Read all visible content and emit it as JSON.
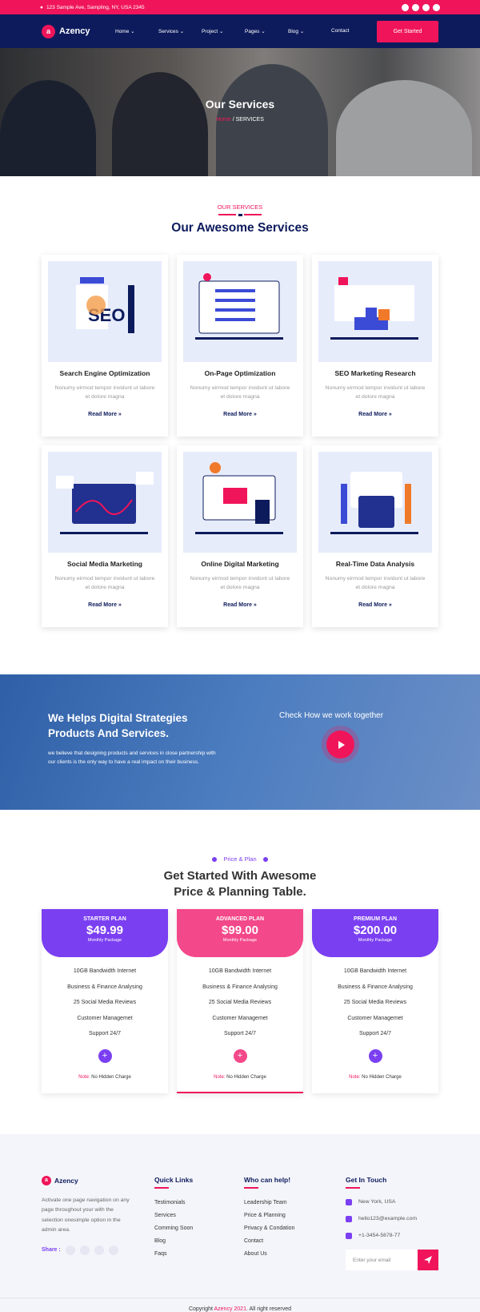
{
  "topbar": {
    "address": "123 Sample Ave, Sampling, NY, USA 2345"
  },
  "nav": {
    "brand": "Azency",
    "items": [
      "Home",
      "Services",
      "Project",
      "Pages",
      "Blog",
      "Contact"
    ],
    "cta": "Get Started"
  },
  "hero": {
    "title": "Our Services",
    "crumb_home": "Home",
    "crumb_current": " / SERVICES"
  },
  "services": {
    "eyebrow": "OUR SERVICES",
    "title": "Our Awesome Services",
    "cards": [
      {
        "title": "Search Engine Optimization",
        "text": "Nonumy eirmod tempor invidunt ut labore et dolore magna",
        "link": "Read More"
      },
      {
        "title": "On-Page Optimization",
        "text": "Nonumy eirmod tempor invidunt ut labore et dolore magna",
        "link": "Read More"
      },
      {
        "title": "SEO Marketing Research",
        "text": "Nonumy eirmod tempor invidunt ut labore et dolore magna",
        "link": "Read More"
      },
      {
        "title": "Social Media Marketing",
        "text": "Nonumy eirmod tempor invidunt ut labore et dolore magna",
        "link": "Read More"
      },
      {
        "title": "Online Digital Marketing",
        "text": "Nonumy eirmod tempor invidunt ut labore et dolore magna",
        "link": "Read More"
      },
      {
        "title": "Real-Time Data Analysis",
        "text": "Nonumy eirmod tempor invidunt ut labore et dolore magna",
        "link": "Read More"
      }
    ]
  },
  "strategy": {
    "title_line1": "We Helps Digital Strategies",
    "title_line2": "Products And Services.",
    "text": "we believe that designing products and services in close partnership with our clients is the only way to have a real impact on their business.",
    "video_label": "Check How we work together"
  },
  "pricing": {
    "eyebrow": "Price & Plan",
    "title_line1": "Get Started With Awesome",
    "title_line2": "Price & Planning Table.",
    "plans": [
      {
        "name": "STARTER PLAN",
        "price": "$49.99",
        "period": "Monthly Package",
        "color": "#7b3ff2"
      },
      {
        "name": "ADVANCED PLAN",
        "price": "$99.00",
        "period": "Monthly Package",
        "color": "#f3488a"
      },
      {
        "name": "PREMIUM PLAN",
        "price": "$200.00",
        "period": "Monthly Package",
        "color": "#7b3ff2"
      }
    ],
    "features": [
      "10GB Bandwidth Internet",
      "Business & Finance Analysing",
      "25 Social Media Reviews",
      "Customer Managemet",
      "Support 24/7"
    ],
    "note_label": "Note:",
    "note_text": " No Hidden Charge"
  },
  "footer": {
    "brand": "Azency",
    "about": "Activate one page navigation on any page throughout your with the selection onesimple option in the admin area.",
    "share_label": "Share :",
    "quick_title": "Quick Links",
    "quick_links": [
      "Testimonials",
      "Services",
      "Comming Soon",
      "Blog",
      "Faqs"
    ],
    "help_title": "Who can help!",
    "help_links": [
      "Leadership Team",
      "Price & Planning",
      "Privacy & Condation",
      "Contact",
      "About Us"
    ],
    "touch_title": "Get In Touch",
    "location": "New York, USA",
    "email": "hello123@example.com",
    "phone": "+1-3454-5678-77",
    "email_placeholder": "Enter your email",
    "copyright_pre": "Copyright ",
    "copyright_brand": "Azency 2021",
    "copyright_post": ". All right reserved"
  },
  "colors": {
    "primary": "#f0155a",
    "navy": "#0d1b5c",
    "purple": "#7b3ff2"
  }
}
